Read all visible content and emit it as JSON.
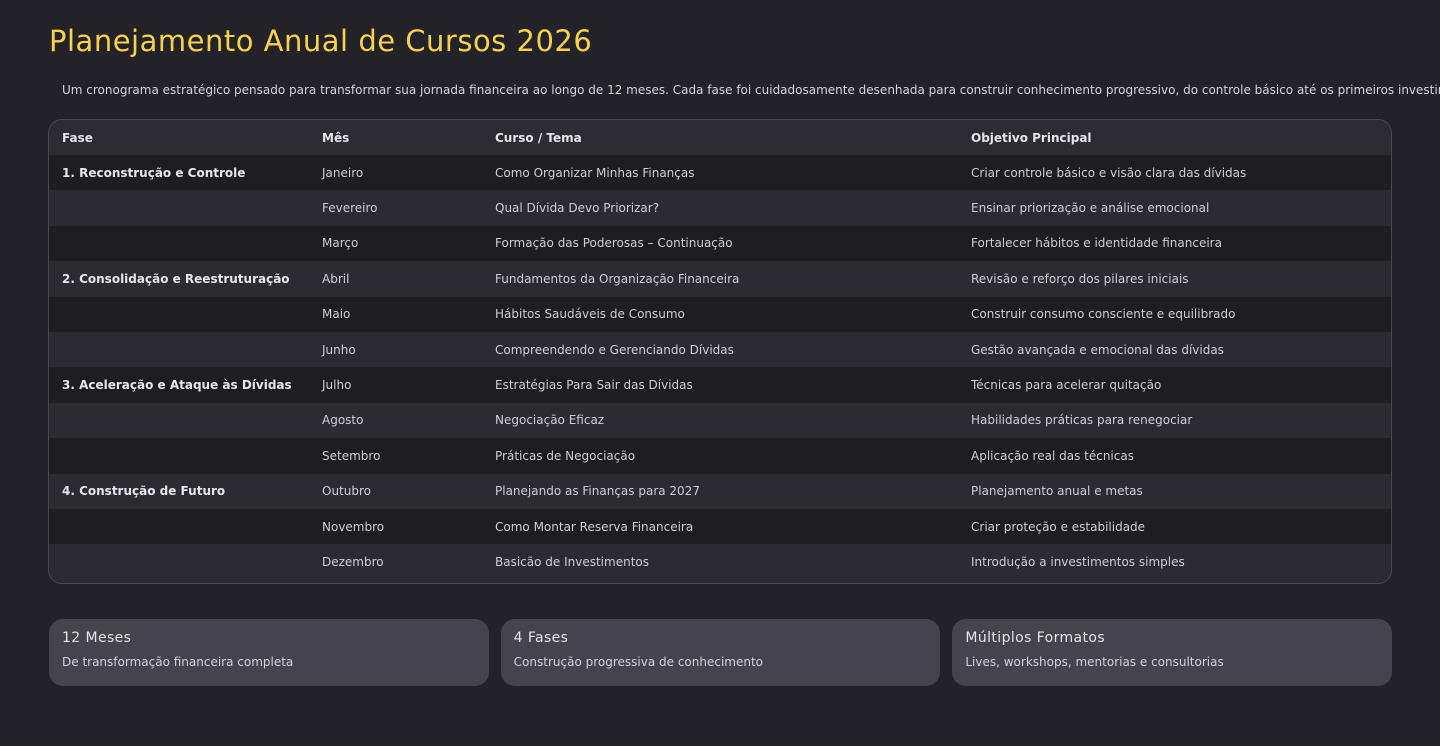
{
  "header": {
    "title": "Planejamento Anual de Cursos 2026",
    "intro": "Um cronograma estratégico pensado para transformar sua jornada financeira ao longo de 12 meses. Cada fase foi cuidadosamente desenhada para construir conhecimento progressivo, do controle básico até os primeiros investimentos."
  },
  "table": {
    "columns": [
      "Fase",
      "Mês",
      "Curso / Tema",
      "Objetivo Principal"
    ],
    "rows": [
      {
        "fase": "1. Reconstrução e Controle",
        "mes": "Janeiro",
        "curso": "Como Organizar Minhas Finanças",
        "objetivo": "Criar controle básico e visão clara das dívidas"
      },
      {
        "fase": "",
        "mes": "Fevereiro",
        "curso": "Qual Dívida Devo Priorizar?",
        "objetivo": "Ensinar priorização e análise emocional"
      },
      {
        "fase": "",
        "mes": "Março",
        "curso": "Formação das Poderosas – Continuação",
        "objetivo": "Fortalecer hábitos e identidade financeira"
      },
      {
        "fase": "2. Consolidação e Reestruturação",
        "mes": "Abril",
        "curso": "Fundamentos da Organização Financeira",
        "objetivo": "Revisão e reforço dos pilares iniciais"
      },
      {
        "fase": "",
        "mes": "Maio",
        "curso": "Hábitos Saudáveis de Consumo",
        "objetivo": "Construir consumo consciente e equilibrado"
      },
      {
        "fase": "",
        "mes": "Junho",
        "curso": "Compreendendo e Gerenciando Dívidas",
        "objetivo": "Gestão avançada e emocional das dívidas"
      },
      {
        "fase": "3. Aceleração e Ataque às Dívidas",
        "mes": "Julho",
        "curso": "Estratégias Para Sair das Dívidas",
        "objetivo": "Técnicas para acelerar quitação"
      },
      {
        "fase": "",
        "mes": "Agosto",
        "curso": "Negociação Eficaz",
        "objetivo": "Habilidades práticas para renegociar"
      },
      {
        "fase": "",
        "mes": "Setembro",
        "curso": "Práticas de Negociação",
        "objetivo": "Aplicação real das técnicas"
      },
      {
        "fase": "4. Construção de Futuro",
        "mes": "Outubro",
        "curso": "Planejando as Finanças para 2027",
        "objetivo": "Planejamento anual e metas"
      },
      {
        "fase": "",
        "mes": "Novembro",
        "curso": "Como Montar Reserva Financeira",
        "objetivo": "Criar proteção e estabilidade"
      },
      {
        "fase": "",
        "mes": "Dezembro",
        "curso": "Basicão de Investimentos",
        "objetivo": "Introdução a investimentos simples"
      }
    ]
  },
  "cards": [
    {
      "title": "12 Meses",
      "text": "De transformação financeira completa"
    },
    {
      "title": "4 Fases",
      "text": "Construção progressiva de conhecimento"
    },
    {
      "title": "Múltiplos Formatos",
      "text": "Lives, workshops, mentorias e consultorias"
    }
  ],
  "colors": {
    "background": "#232228",
    "accent": "#F5D24A",
    "card": "#45444C"
  }
}
